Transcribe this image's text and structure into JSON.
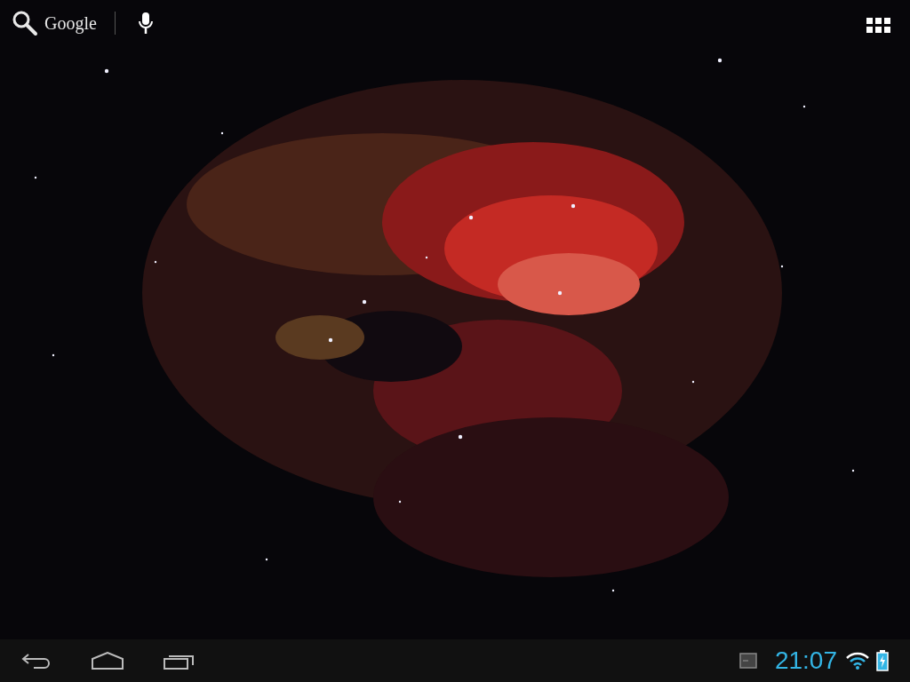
{
  "search_bar": {
    "label": "Google"
  },
  "status_bar": {
    "time": "21:07",
    "battery_charging": true
  }
}
